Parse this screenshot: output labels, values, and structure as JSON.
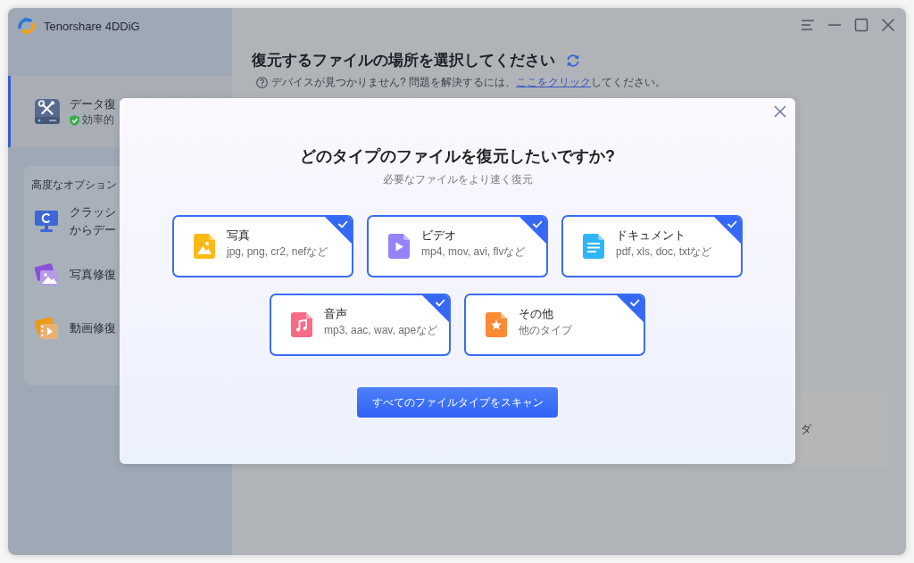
{
  "app": {
    "name": "Tenorshare 4DDiG"
  },
  "sidebar": {
    "items": [
      {
        "kind": "recovery",
        "title": "データ復",
        "subtitle": "効率的",
        "selected": true
      }
    ],
    "advanced_options": {
      "heading": "高度なオプション",
      "items": [
        {
          "kind": "crash",
          "lines": [
            "クラッシ",
            "からデー"
          ],
          "selected": false
        },
        {
          "kind": "photo",
          "lines": [
            "写真修復"
          ],
          "selected": false
        },
        {
          "kind": "video",
          "lines": [
            "動画修復"
          ],
          "selected": false
        }
      ]
    }
  },
  "main": {
    "title": "復元するファイルの場所を選択してください",
    "help": {
      "before": "デバイスが見つかりません? 問題を解決するには、",
      "link": "ここをクリック",
      "after": "してください。"
    },
    "location_card": {
      "label": "ダ"
    }
  },
  "dialog": {
    "title": "どのタイプのファイルを復元したいですか?",
    "subtitle": "必要なファイルをより速く復元",
    "file_types": [
      {
        "kind": "image",
        "name": "写真",
        "extensions": "jpg, png, cr2, nefなど",
        "color": "#fdb915",
        "selected": true
      },
      {
        "kind": "video",
        "name": "ビデオ",
        "extensions": "mp4, mov, avi, flvなど",
        "color": "#9483f9",
        "selected": true
      },
      {
        "kind": "document",
        "name": "ドキュメント",
        "extensions": "pdf, xls, doc, txtなど",
        "color": "#2fb5f8",
        "selected": true
      },
      {
        "kind": "audio",
        "name": "音声",
        "extensions": "mp3, aac, wav, apeなど",
        "color": "#f66b86",
        "selected": true
      },
      {
        "kind": "other",
        "name": "その他",
        "extensions": "他のタイプ",
        "color": "#fd8a34",
        "selected": true
      }
    ],
    "scan_button": "すべてのファイルタイプをスキャン"
  }
}
